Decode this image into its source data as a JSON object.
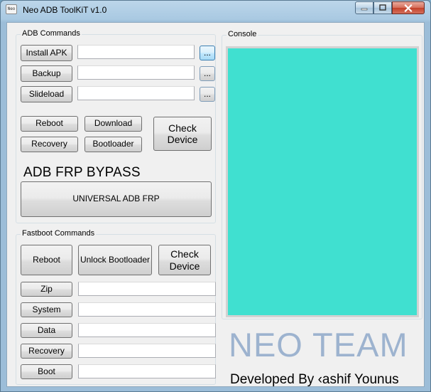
{
  "window": {
    "title": "Neo ADB ToolKiT v1.0",
    "icon_name": "app-icon",
    "icon_text": "Neo"
  },
  "adb": {
    "group_label": "ADB Commands",
    "rows": [
      {
        "button": "Install APK",
        "value": "",
        "browse": "..."
      },
      {
        "button": "Backup",
        "value": "",
        "browse": "..."
      },
      {
        "button": "Slideload",
        "value": "",
        "browse": "..."
      }
    ],
    "reboot": "Reboot",
    "download": "Download",
    "recovery": "Recovery",
    "bootloader": "Bootloader",
    "check_device": "Check\nDevice",
    "frp_heading": "ADB FRP BYPASS",
    "frp_button": "UNIVERSAL ADB FRP"
  },
  "fastboot": {
    "group_label": "Fastboot Commands",
    "reboot": "Reboot",
    "unlock": "Unlock Bootloader",
    "check_device": "Check\nDevice",
    "rows": [
      {
        "button": "Zip",
        "value": ""
      },
      {
        "button": "System",
        "value": ""
      },
      {
        "button": "Data",
        "value": ""
      },
      {
        "button": "Recovery",
        "value": ""
      },
      {
        "button": "Boot",
        "value": ""
      }
    ]
  },
  "console": {
    "group_label": "Console",
    "text": "",
    "background": "#40e0d0"
  },
  "branding": {
    "team": "NEO TEAM",
    "credit": "Developed By ‹ashif Younus",
    "team_color": "#9db3cf"
  }
}
